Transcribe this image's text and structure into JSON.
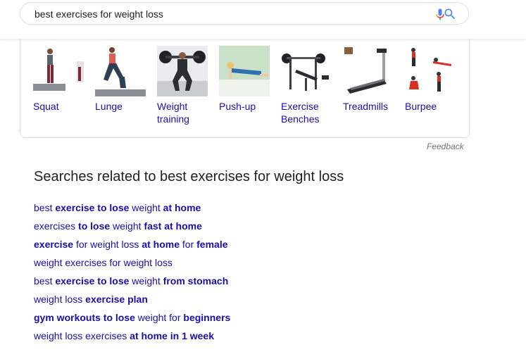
{
  "search": {
    "query": "best exercises for weight loss",
    "mic_icon": "mic-icon",
    "search_icon": "search-icon"
  },
  "exercises": [
    {
      "label": "Squat",
      "icon": "squat-image"
    },
    {
      "label": "Lunge",
      "icon": "lunge-image"
    },
    {
      "label": "Weight training",
      "icon": "weight-training-image"
    },
    {
      "label": "Push-up",
      "icon": "push-up-image"
    },
    {
      "label": "Exercise Benches",
      "icon": "exercise-bench-image"
    },
    {
      "label": "Treadmills",
      "icon": "treadmill-image"
    },
    {
      "label": "Burpee",
      "icon": "burpee-image"
    }
  ],
  "feedback": "Feedback",
  "related": {
    "title": "Searches related to best exercises for weight loss",
    "items": [
      [
        {
          "t": "best ",
          "b": false
        },
        {
          "t": "exercise to lose",
          "b": true
        },
        {
          "t": " weight ",
          "b": false
        },
        {
          "t": "at home",
          "b": true
        }
      ],
      [
        {
          "t": "exercises ",
          "b": false
        },
        {
          "t": "to lose",
          "b": true
        },
        {
          "t": " weight ",
          "b": false
        },
        {
          "t": "fast at home",
          "b": true
        }
      ],
      [
        {
          "t": "exercise",
          "b": true
        },
        {
          "t": " for weight loss ",
          "b": false
        },
        {
          "t": "at home",
          "b": true
        },
        {
          "t": " for ",
          "b": false
        },
        {
          "t": "female",
          "b": true
        }
      ],
      [
        {
          "t": "weight exercises for weight loss",
          "b": false
        }
      ],
      [
        {
          "t": "best ",
          "b": false
        },
        {
          "t": "exercise to lose",
          "b": true
        },
        {
          "t": " weight ",
          "b": false
        },
        {
          "t": "from stomach",
          "b": true
        }
      ],
      [
        {
          "t": "weight loss ",
          "b": false
        },
        {
          "t": "exercise plan",
          "b": true
        }
      ],
      [
        {
          "t": "gym workouts to lose",
          "b": true
        },
        {
          "t": " weight for ",
          "b": false
        },
        {
          "t": "beginners",
          "b": true
        }
      ],
      [
        {
          "t": "weight loss exercises ",
          "b": false
        },
        {
          "t": "at home in 1 week",
          "b": true
        }
      ]
    ]
  },
  "colors": {
    "link": "#1a0dab",
    "text": "#202124",
    "muted": "#70757a",
    "border": "#dadce0"
  }
}
